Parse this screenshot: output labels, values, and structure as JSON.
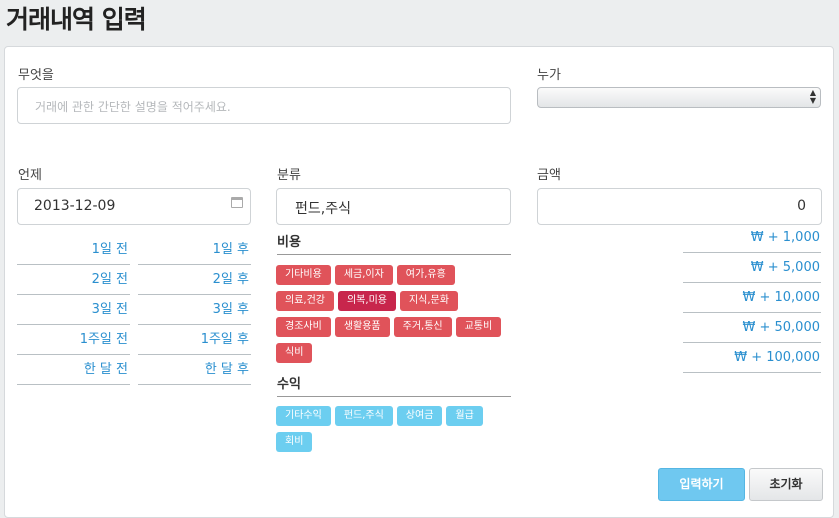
{
  "title": "거래내역 입력",
  "what": {
    "label": "무엇을",
    "placeholder": "거래에 관한 간단한 설명을 적어주세요."
  },
  "who": {
    "label": "누가",
    "value": ""
  },
  "when": {
    "label": "언제",
    "value": "2013-12-09"
  },
  "category": {
    "label": "분류",
    "value": "펀드,주식"
  },
  "amount": {
    "label": "금액",
    "value": "0"
  },
  "date_shortcuts": {
    "before": [
      "1일 전",
      "2일 전",
      "3일 전",
      "1주일 전",
      "한 달 전"
    ],
    "after": [
      "1일 후",
      "2일 후",
      "3일 후",
      "1주일 후",
      "한 달 후"
    ]
  },
  "expense": {
    "title": "비용",
    "tags": [
      "기타비용",
      "세금,이자",
      "여가,유흥",
      "의료,건강",
      "의복,미용",
      "지식,문화",
      "경조사비",
      "생활용품",
      "주거,통신",
      "교통비",
      "식비"
    ],
    "active_tag": "의복,미용"
  },
  "income": {
    "title": "수익",
    "tags": [
      "기타수익",
      "펀드,주식",
      "상여금",
      "월급",
      "회비"
    ]
  },
  "amount_buttons": [
    "₩ + 1,000",
    "₩ + 5,000",
    "₩ + 10,000",
    "₩ + 50,000",
    "₩ + 100,000"
  ],
  "actions": {
    "submit": "입력하기",
    "reset": "초기화"
  },
  "colors": {
    "expense_tag": "#e0535a",
    "expense_tag_active": "#c8264c",
    "income_tag": "#6ccef0",
    "link": "#2a8fcf",
    "primary_button": "#6fc8f0"
  }
}
